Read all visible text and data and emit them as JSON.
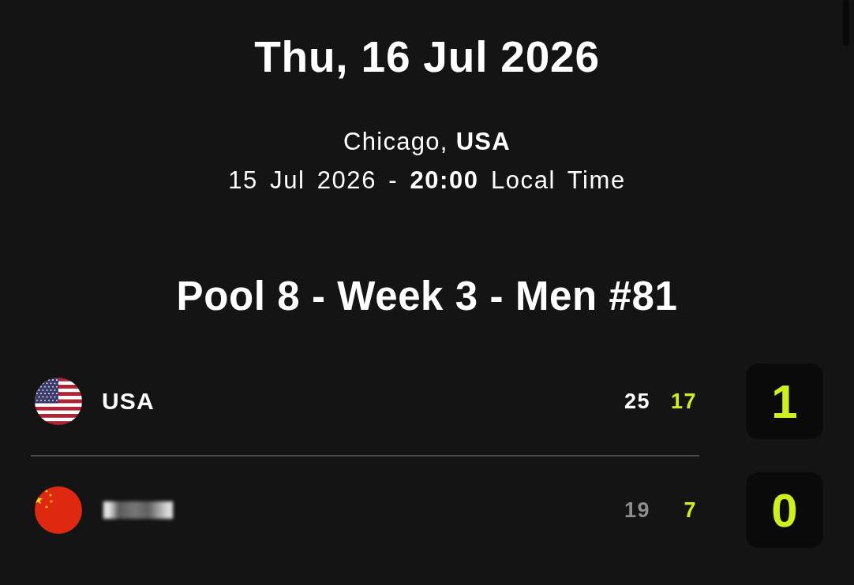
{
  "header": {
    "date": "Thu, 16 Jul 2026",
    "location": "Chicago, **USA**",
    "schedule": "15 Jul 2026 - **20:00** Local Time"
  },
  "match": {
    "title": "Pool 8 - Week 3 - Men #81",
    "teams": [
      {
        "name": "USA",
        "redacted": false,
        "sets": [
          {
            "score": "25",
            "kind": "won"
          },
          {
            "score": "17",
            "kind": "current"
          }
        ],
        "match_score": "1"
      },
      {
        "redacted": true,
        "sets": [
          {
            "score": "19",
            "kind": "lost"
          },
          {
            "score": "7",
            "kind": "current"
          }
        ],
        "match_score": "0"
      }
    ]
  }
}
